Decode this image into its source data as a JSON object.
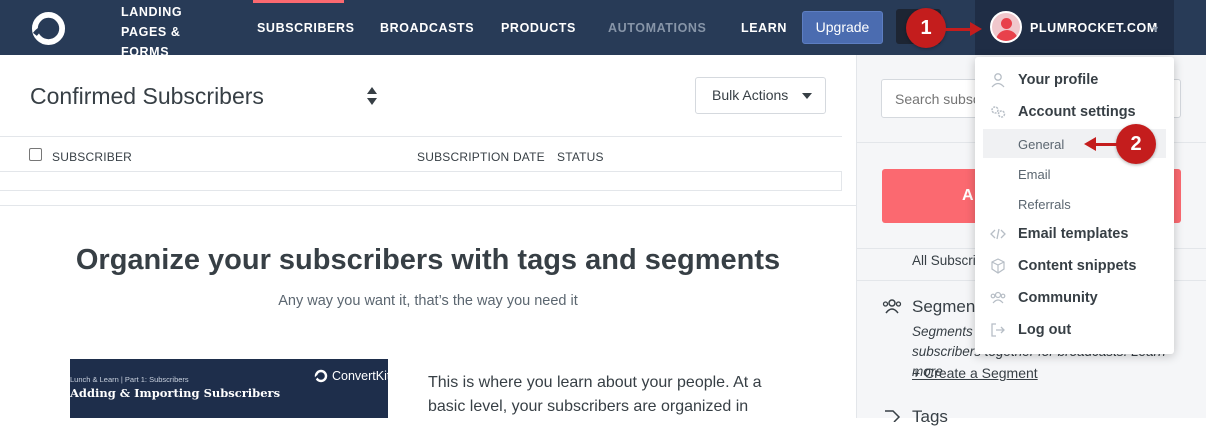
{
  "nav": {
    "items": [
      {
        "label": "LANDING\nPAGES &\nFORMS"
      },
      {
        "label": "SUBSCRIBERS"
      },
      {
        "label": "BROADCASTS"
      },
      {
        "label": "PRODUCTS"
      },
      {
        "label": "AUTOMATIONS"
      },
      {
        "label": "LEARN"
      }
    ],
    "upgrade_label": "Upgrade",
    "account_name": "PLUMROCKET.COM",
    "accent_color": "#fb6970",
    "bg_color": "#283b57"
  },
  "markers": {
    "one": "1",
    "two": "2"
  },
  "main": {
    "title": "Confirmed Subscribers",
    "bulk_actions": "Bulk Actions",
    "columns": {
      "subscriber": "SUBSCRIBER",
      "date": "SUBSCRIPTION DATE",
      "status": "STATUS"
    },
    "org_title": "Organize your subscribers with tags and segments",
    "org_subtitle": "Any way you want it, that’s the way you need it",
    "video": {
      "small": "Lunch & Learn | Part 1: Subscribers",
      "title": "Adding & Importing Subscribers",
      "brand": "ConvertKit"
    },
    "learn_text": "This is where you learn about your people. At a basic level, your subscribers are organized in"
  },
  "sidebar": {
    "search_placeholder": "Search subscribers",
    "add_button": "A",
    "all_subscribers": "All Subscribers",
    "segments_title": "Segments",
    "segments_desc": "Segments let you group tags and subscribers together for broadcasts. Learn more",
    "create_segment": "+ Create a Segment",
    "tags_title": "Tags"
  },
  "dropdown": {
    "your_profile": "Your profile",
    "account_settings": "Account settings",
    "general": "General",
    "email": "Email",
    "referrals": "Referrals",
    "email_templates": "Email templates",
    "content_snippets": "Content snippets",
    "community": "Community",
    "log_out": "Log out"
  }
}
